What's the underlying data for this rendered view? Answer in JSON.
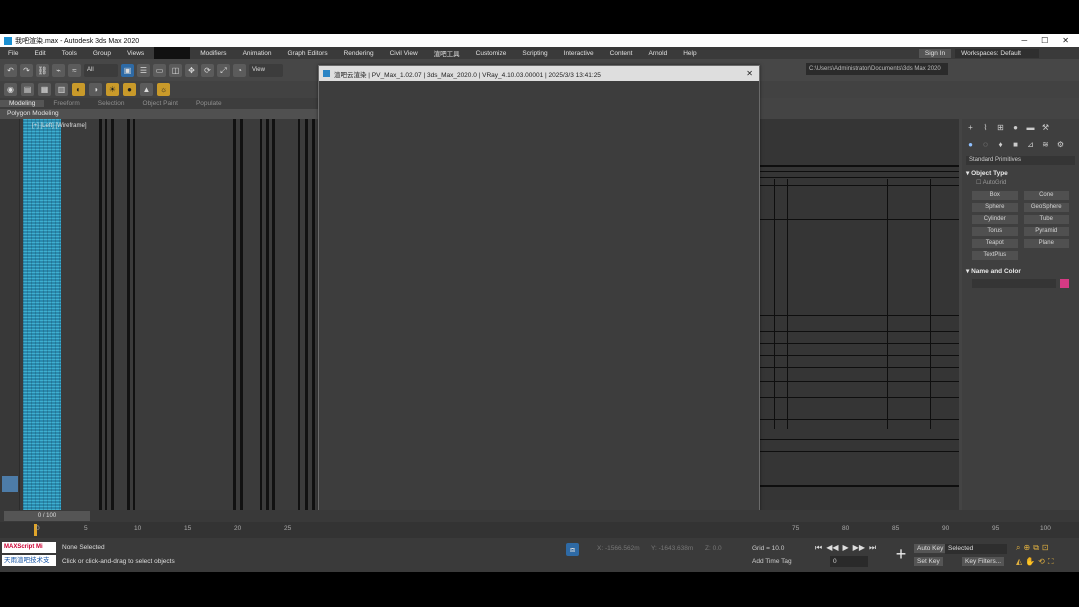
{
  "window": {
    "title": "我吧渲染.max - Autodesk 3ds Max 2020",
    "controls": [
      "─",
      "☐",
      "✕"
    ]
  },
  "menu": {
    "items_left": [
      "File",
      "Edit",
      "Tools",
      "Group",
      "Views"
    ],
    "items_right": [
      "Modifiers",
      "Animation",
      "Graph Editors",
      "Rendering",
      "Civil View",
      "渲吧工具",
      "Customize",
      "Scripting",
      "Interactive",
      "Content",
      "Arnold",
      "Help"
    ],
    "sign_in": "Sign In",
    "workspaces": "Workspaces: Default"
  },
  "toolbar": {
    "selection_filter": "All",
    "view_dropdown": "View",
    "path": "C:\\Users\\Administrator\\Documents\\3ds Max 2020"
  },
  "ribbon": {
    "tabs": [
      "Modeling",
      "Freeform",
      "Selection",
      "Object Paint",
      "Populate"
    ],
    "active_tab": "Modeling",
    "panel_label": "Polygon Modeling"
  },
  "viewport": {
    "label": "[+] [Left] [Wireframe]"
  },
  "dialog": {
    "title": "渲吧云渲染 | PV_Max_1.02.07 | 3ds_Max_2020.0 | VRay_4.10.03.00001 | 2025/3/3 13:41:25"
  },
  "command_panel": {
    "tab_icons": [
      "create-icon",
      "modify-icon",
      "hierarchy-icon",
      "motion-icon",
      "display-icon",
      "utilities-icon"
    ],
    "category_icons": [
      "geometry-icon",
      "shapes-icon",
      "lights-icon",
      "cameras-icon",
      "helpers-icon",
      "spacewarps-icon",
      "systems-icon"
    ],
    "dropdown": "Standard Primitives",
    "object_type_title": "Object Type",
    "autogrid": "AutoGrid",
    "objects": [
      "Box",
      "Cone",
      "Sphere",
      "GeoSphere",
      "Cylinder",
      "Tube",
      "Torus",
      "Pyramid",
      "Teapot",
      "Plane",
      "TextPlus"
    ],
    "name_color_title": "Name and Color",
    "color": "#d63a84"
  },
  "timeline": {
    "slider_label": "0 / 100",
    "ticks_left": [
      "0",
      "5",
      "10",
      "15",
      "20",
      "25"
    ],
    "ticks_right": [
      "75",
      "80",
      "85",
      "90",
      "95",
      "100"
    ]
  },
  "status": {
    "maxscript_label": "MAXScript Mi",
    "brand": "天雨渲吧技术支",
    "selected_text": "None Selected",
    "prompt_text": "Click or click-and-drag to select objects",
    "x_label": "X: -1566.562m",
    "y_label": "Y: -1643.638m",
    "z_label": "Z: 0.0",
    "grid": "Grid = 10.0",
    "add_time_tag": "Add Time Tag",
    "frame_value": "0",
    "auto_key": "Auto Key",
    "set_key": "Set Key",
    "selected_dropdown": "Selected",
    "key_filters": "Key Filters..."
  }
}
